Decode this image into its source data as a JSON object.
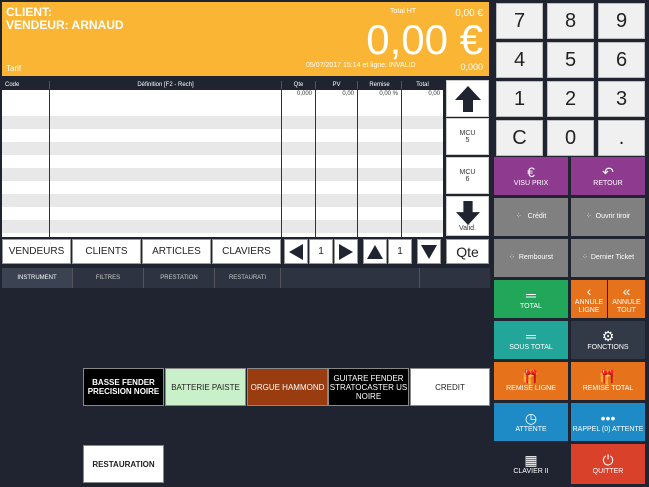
{
  "header": {
    "client": "CLIENT:",
    "vendeur": "VENDEUR: ARNAUD",
    "tarif": "Tarif",
    "total_ht_label": "Total HT",
    "total_ht_value": "0,00 €",
    "total_big": "0,00 €",
    "datetime": "05/07/2017 15:14 et ligne: INVALID",
    "small_value": "0,000",
    "bg_color": "#fbb534"
  },
  "table": {
    "headers": [
      "Code",
      "Définition [F2 - Rech]",
      "Qte",
      "PV",
      "Remise",
      "Total"
    ],
    "first_row": [
      "",
      "",
      "0,000",
      "0,00",
      "0,00 %",
      "0,00"
    ],
    "empty_rows": 11
  },
  "nav": {
    "up_icon": "arrow-up-icon",
    "mcu5_label": "MCU",
    "mcu5_num": "5",
    "mcu6_label": "MCU",
    "mcu6_num": "6",
    "valid_label": "Valid."
  },
  "categories": {
    "vendeurs": "VENDEURS",
    "clients": "CLIENTS",
    "articles": "ARTICLES",
    "claviers": "CLAVIERS",
    "page1": "1",
    "page2": "1",
    "qte": "Qte"
  },
  "tabs": [
    "INSTRUMENT",
    "FILTRES",
    "PRESTATION",
    "RESTAURATI"
  ],
  "products": {
    "basse": "BASSE FENDER PRECISION NOIRE",
    "batterie": "BATTERIE PAISTE",
    "orgue": "ORGUE HAMMOND",
    "guitare": "GUITARE FENDER STRATOCASTER US NOIRE",
    "credit": "CREDIT",
    "restauration": "RESTAURATION"
  },
  "keypad": [
    "7",
    "8",
    "9",
    "4",
    "5",
    "6",
    "1",
    "2",
    "3",
    "C",
    "0",
    "."
  ],
  "functions": {
    "visu_prix": "VISU PRIX",
    "retour": "RETOUR",
    "credit": "Crédit",
    "ouvrir_tiroir": "Ouvrir tiroir",
    "rembourst": "Rembourst",
    "dernier_ticket": "Dernier Ticket",
    "total": "TOTAL",
    "annule_ligne": "ANNULE LIGNE",
    "annule_tout": "ANNULE TOUT",
    "sous_total": "SOUS TOTAL",
    "fonctions": "FONCTIONS",
    "remise_ligne": "REMISE LIGNE",
    "remise_total": "REMISE TOTAL",
    "attente": "ATTENTE",
    "rappel": "RAPPEL (0) ATTENTE",
    "clavier": "CLAVIER II",
    "quitter": "QUITTER"
  },
  "colors": {
    "purple": "#8e3a8f",
    "gray": "#808080",
    "green": "#22a65a",
    "orange": "#e6731c",
    "teal": "#22a69a",
    "dark": "#333a47",
    "blue": "#1e8bc7",
    "red": "#d9412b"
  }
}
